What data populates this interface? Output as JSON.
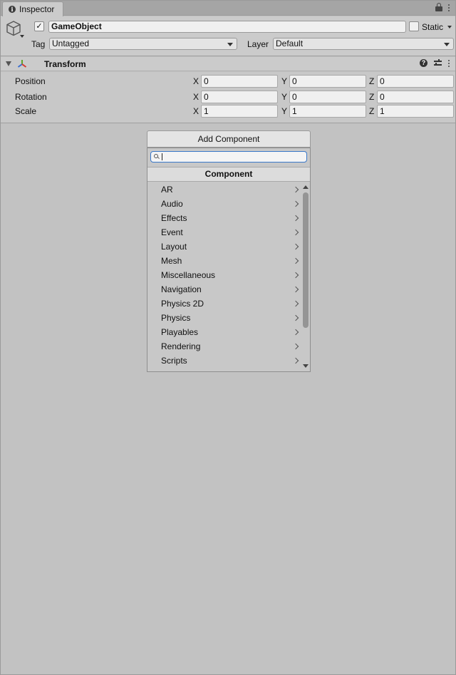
{
  "tab": {
    "title": "Inspector"
  },
  "header": {
    "active": true,
    "name": "GameObject",
    "static_label": "Static",
    "tag_label": "Tag",
    "tag_value": "Untagged",
    "layer_label": "Layer",
    "layer_value": "Default"
  },
  "transform": {
    "title": "Transform",
    "rows": [
      {
        "label": "Position",
        "x": "0",
        "y": "0",
        "z": "0"
      },
      {
        "label": "Rotation",
        "x": "0",
        "y": "0",
        "z": "0"
      },
      {
        "label": "Scale",
        "x": "1",
        "y": "1",
        "z": "1"
      }
    ],
    "axis": {
      "x": "X",
      "y": "Y",
      "z": "Z"
    }
  },
  "add_component": {
    "button_label": "Add Component",
    "search_value": "",
    "header": "Component",
    "items": [
      "AR",
      "Audio",
      "Effects",
      "Event",
      "Layout",
      "Mesh",
      "Miscellaneous",
      "Navigation",
      "Physics 2D",
      "Physics",
      "Playables",
      "Rendering",
      "Scripts"
    ]
  },
  "icons": {
    "tab": "info-icon",
    "tab_tools": [
      "lock-icon",
      "more-options-icon"
    ],
    "object": "cube-icon",
    "transform": "transform-axes-icon",
    "transform_tools": [
      "help-icon",
      "presets-icon",
      "more-options-icon"
    ]
  },
  "colors": {
    "panel": "#c2c2c2",
    "header": "#cbcbcb",
    "search_focus": "#3a78c9",
    "axis_x": "#d23b2f",
    "axis_y": "#5fa52b",
    "axis_z": "#3a6fd0"
  }
}
